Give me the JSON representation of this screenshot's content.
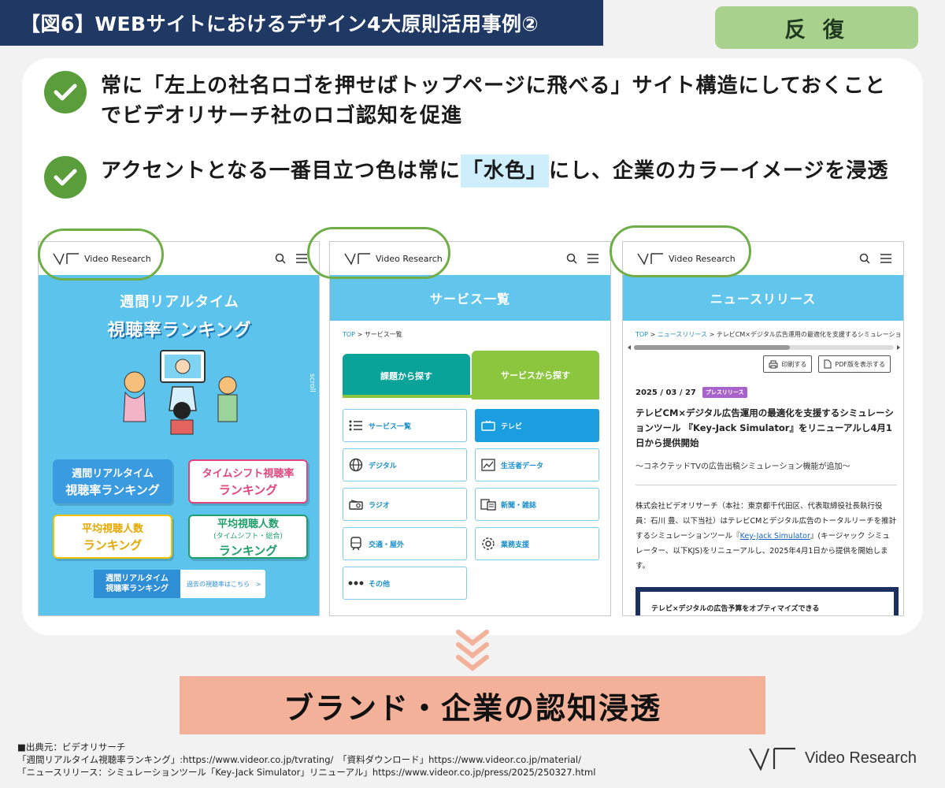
{
  "header": {
    "title": "【図6】WEBサイトにおけるデザイン4大原則活用事例②",
    "tag": "反 復"
  },
  "bullets": [
    {
      "text": "常に「左上の社名ロゴを押せばトップページに飛べる」サイト構造にしておくことでビデオリサーチ社のロゴ認知を促進"
    },
    {
      "text_before": "アクセントとなる一番目立つ色は常に",
      "highlight": "「水色」",
      "text_after": "にし、企業のカラーイメージを浸透"
    }
  ],
  "brand": {
    "name": "Video Research"
  },
  "screen1": {
    "title_line1": "週間リアルタイム",
    "title_line2": "視聴率ランキング",
    "scroll": "scroll",
    "buttons": [
      {
        "line1": "週間リアルタイム",
        "line2": "視聴率ランキング"
      },
      {
        "line1": "タイムシフト視聴率",
        "line2": "ランキング"
      },
      {
        "line1": "平均視聴人数",
        "line2": "ランキング"
      },
      {
        "line1": "平均視聴人数",
        "note": "(タイムシフト・総合)",
        "line2": "ランキング"
      }
    ],
    "archive": {
      "line1": "週間リアルタイム",
      "line2": "視聴率ランキング",
      "link": "過去の視聴率はこちら",
      "arrow": ">"
    }
  },
  "screen2": {
    "band": "サービス一覧",
    "crumb_top": "TOP",
    "crumb_sep": ">",
    "crumb_current": "サービス一覧",
    "tab1": "課題から探す",
    "tab2": "サービスから探す",
    "items": [
      {
        "label": "サービス一覧",
        "icon": "list-icon"
      },
      {
        "label": "テレビ",
        "icon": "tv-icon"
      },
      {
        "label": "デジタル",
        "icon": "globe-icon"
      },
      {
        "label": "生活者データ",
        "icon": "chart-icon"
      },
      {
        "label": "ラジオ",
        "icon": "radio-icon"
      },
      {
        "label": "新聞・雑誌",
        "icon": "newspaper-icon"
      },
      {
        "label": "交通・屋外",
        "icon": "train-icon"
      },
      {
        "label": "業務支援",
        "icon": "gear-icon"
      },
      {
        "label": "その他",
        "icon": "dots-icon"
      }
    ]
  },
  "screen3": {
    "band": "ニュースリリース",
    "crumb_top": "TOP",
    "crumb_sep": ">",
    "crumb_news": "ニュースリリース",
    "crumb_current": "テレビCM×デジタル広告運用の最適化を支援するシミュレーショ",
    "print": "印刷する",
    "pdf": "PDF版を表示する",
    "date": "2025 / 03 / 27",
    "press_tag": "プレスリリース",
    "title": "テレビCM×デジタル広告運用の最適化を支援するシミュレーションツール 『Key-Jack Simulator』をリニューアルし4月1日から提供開始",
    "subtitle": "〜コネクテッドTVの広告出稿シミュレーション機能が追加〜",
    "body_1": "株式会社ビデオリサーチ（本社：東京都千代田区、代表取締役社長執行役員：石川 豊、以下当社）はテレビCMとデジタル広告のトータルリーチを推計するシミュレーションツール『",
    "body_link": "Key-Jack Simulator",
    "body_2": "』(キージャック シミュレーター、以下KJS)をリニューアルし、2025年4月1日から提供を開始します。",
    "banner": "テレビ×デジタルの広告予算をオプティマイズできる"
  },
  "conclusion": "ブランド・企業の認知浸透",
  "source": {
    "line1": "■出典元：ビデオリサーチ",
    "line2": "「週間リアルタイム視聴率ランキング」:https://www.videor.co.jp/tvrating/　「資料ダウンロード」https://www.videor.co.jp/material/",
    "line3": "「ニュースリリース：シミュレーションツール「Key-Jack Simulator」リニューアル」https://www.videor.co.jp/press/2025/250327.html"
  },
  "colors": {
    "navy": "#1f3864",
    "green": "#70ad47",
    "sky": "#62c6ec",
    "salmon": "#f4b19a"
  }
}
